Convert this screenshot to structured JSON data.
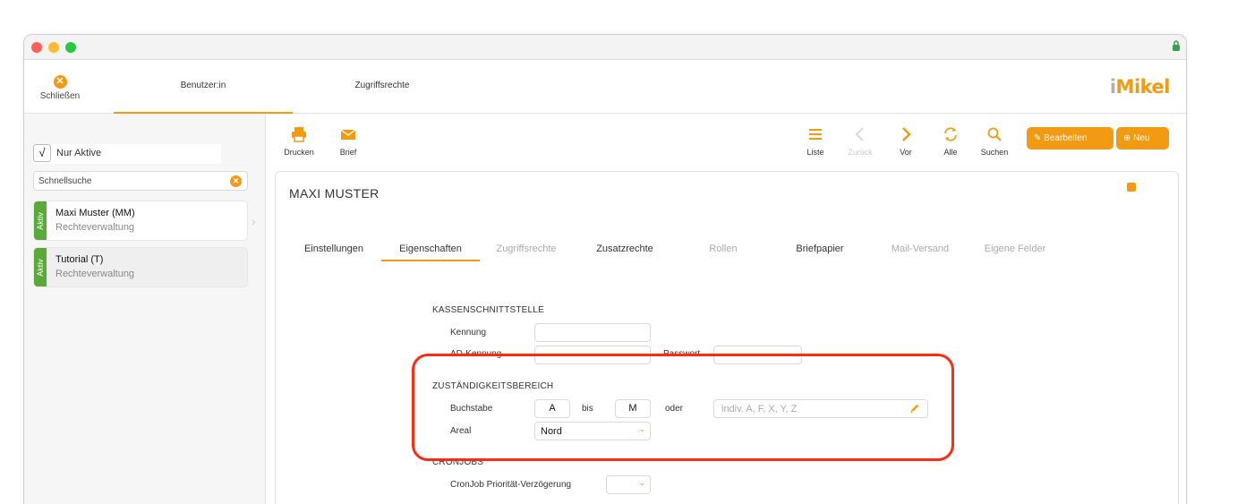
{
  "topnav": {
    "close_label": "Schließen",
    "tabs": [
      {
        "label": "Benutzer:in"
      },
      {
        "label": "Zugriffsrechte"
      }
    ],
    "logo": {
      "prefix": "i",
      "rest": "Mikel"
    }
  },
  "sidebar": {
    "filter_label": "Nur Aktive",
    "filter_checked_glyph": "√",
    "search_value": "Schnellsuche",
    "users": [
      {
        "tag": "Aktiv",
        "name": "Maxi Muster (MM)",
        "role": "Rechteverwaltung"
      },
      {
        "tag": "Aktiv",
        "name": "Tutorial (T)",
        "role": "Rechteverwaltung"
      }
    ]
  },
  "toolbar": {
    "print_label": "Drucken",
    "letter_label": "Brief",
    "list_label": "Liste",
    "back_label": "Zurück",
    "forward_label": "Vor",
    "all_label": "Alle",
    "search_label": "Suchen",
    "edit_label": "Bearbeiten",
    "new_label": "Neu"
  },
  "panel": {
    "title": "MAXI MUSTER",
    "tabs": [
      {
        "label": "Einstellungen"
      },
      {
        "label": "Eigenschaften"
      },
      {
        "label": "Zugriffsrechte"
      },
      {
        "label": "Zusatzrechte"
      },
      {
        "label": "Rollen"
      },
      {
        "label": "Briefpapier"
      },
      {
        "label": "Mail-Versand"
      },
      {
        "label": "Eigene Felder"
      }
    ],
    "kasse": {
      "heading": "KASSENSCHNITTSTELLE",
      "kennung_label": "Kennung",
      "ad_kennung_label": "AD-Kennung",
      "passwort_label": "Passwort"
    },
    "zustaendigkeit": {
      "heading": "ZUSTÄNDIGKEITSBEREICH",
      "buchstabe_label": "Buchstabe",
      "from_value": "A",
      "bis_label": "bis",
      "to_value": "M",
      "oder_label": "oder",
      "indiv_placeholder": "indiv. A, F, X, Y, Z",
      "areal_label": "Areal",
      "areal_value": "Nord"
    },
    "cronjobs": {
      "heading": "CRONJOBS",
      "delay_label": "CronJob Priorität-Verzögerung"
    }
  },
  "colors": {
    "accent": "#f29a12",
    "aktiv": "#5aa93a",
    "highlight": "#ff2b12"
  }
}
